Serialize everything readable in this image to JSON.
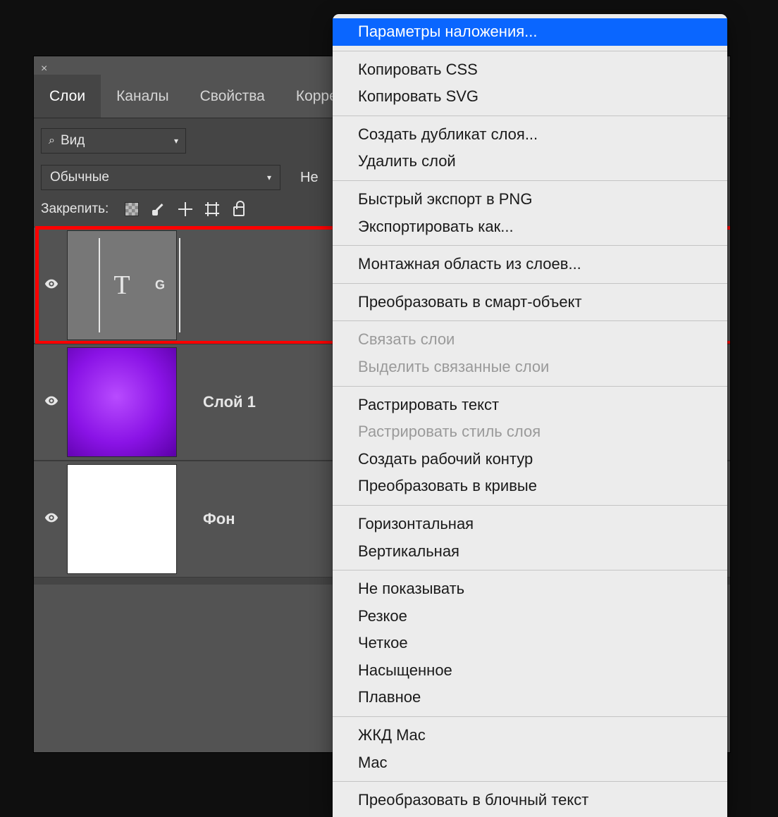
{
  "panel": {
    "close_glyph": "×",
    "tabs": [
      "Слои",
      "Каналы",
      "Свойства",
      "Коррек"
    ],
    "active_tab_index": 0,
    "search_label": "Вид",
    "blend_mode": "Обычные",
    "blend_extra": "Не",
    "lock_label": "Закрепить:",
    "layers": [
      {
        "name": "",
        "thumb": "text",
        "thumb_text": "T",
        "thumb_badge": "G",
        "selected": true
      },
      {
        "name": "Слой 1",
        "thumb": "purple",
        "selected": false
      },
      {
        "name": "Фон",
        "thumb": "white",
        "selected": false
      }
    ]
  },
  "context_menu": {
    "groups": [
      [
        {
          "label": "Параметры наложения...",
          "hl": true
        }
      ],
      [
        {
          "label": "Копировать CSS"
        },
        {
          "label": "Копировать SVG"
        }
      ],
      [
        {
          "label": "Создать дубликат слоя..."
        },
        {
          "label": "Удалить слой"
        }
      ],
      [
        {
          "label": "Быстрый экспорт в PNG"
        },
        {
          "label": "Экспортировать как..."
        }
      ],
      [
        {
          "label": "Монтажная область из слоев..."
        }
      ],
      [
        {
          "label": "Преобразовать в смарт-объект"
        }
      ],
      [
        {
          "label": "Связать слои",
          "disabled": true
        },
        {
          "label": "Выделить связанные слои",
          "disabled": true
        }
      ],
      [
        {
          "label": "Растрировать текст"
        },
        {
          "label": "Растрировать стиль слоя",
          "disabled": true
        },
        {
          "label": "Создать рабочий контур"
        },
        {
          "label": "Преобразовать в кривые"
        }
      ],
      [
        {
          "label": "Горизонтальная"
        },
        {
          "label": "Вертикальная"
        }
      ],
      [
        {
          "label": "Не показывать"
        },
        {
          "label": "Резкое"
        },
        {
          "label": "Четкое"
        },
        {
          "label": "Насыщенное"
        },
        {
          "label": "Плавное"
        }
      ],
      [
        {
          "label": "ЖКД Mac"
        },
        {
          "label": "Mac"
        }
      ],
      [
        {
          "label": "Преобразовать в блочный текст"
        }
      ]
    ]
  }
}
